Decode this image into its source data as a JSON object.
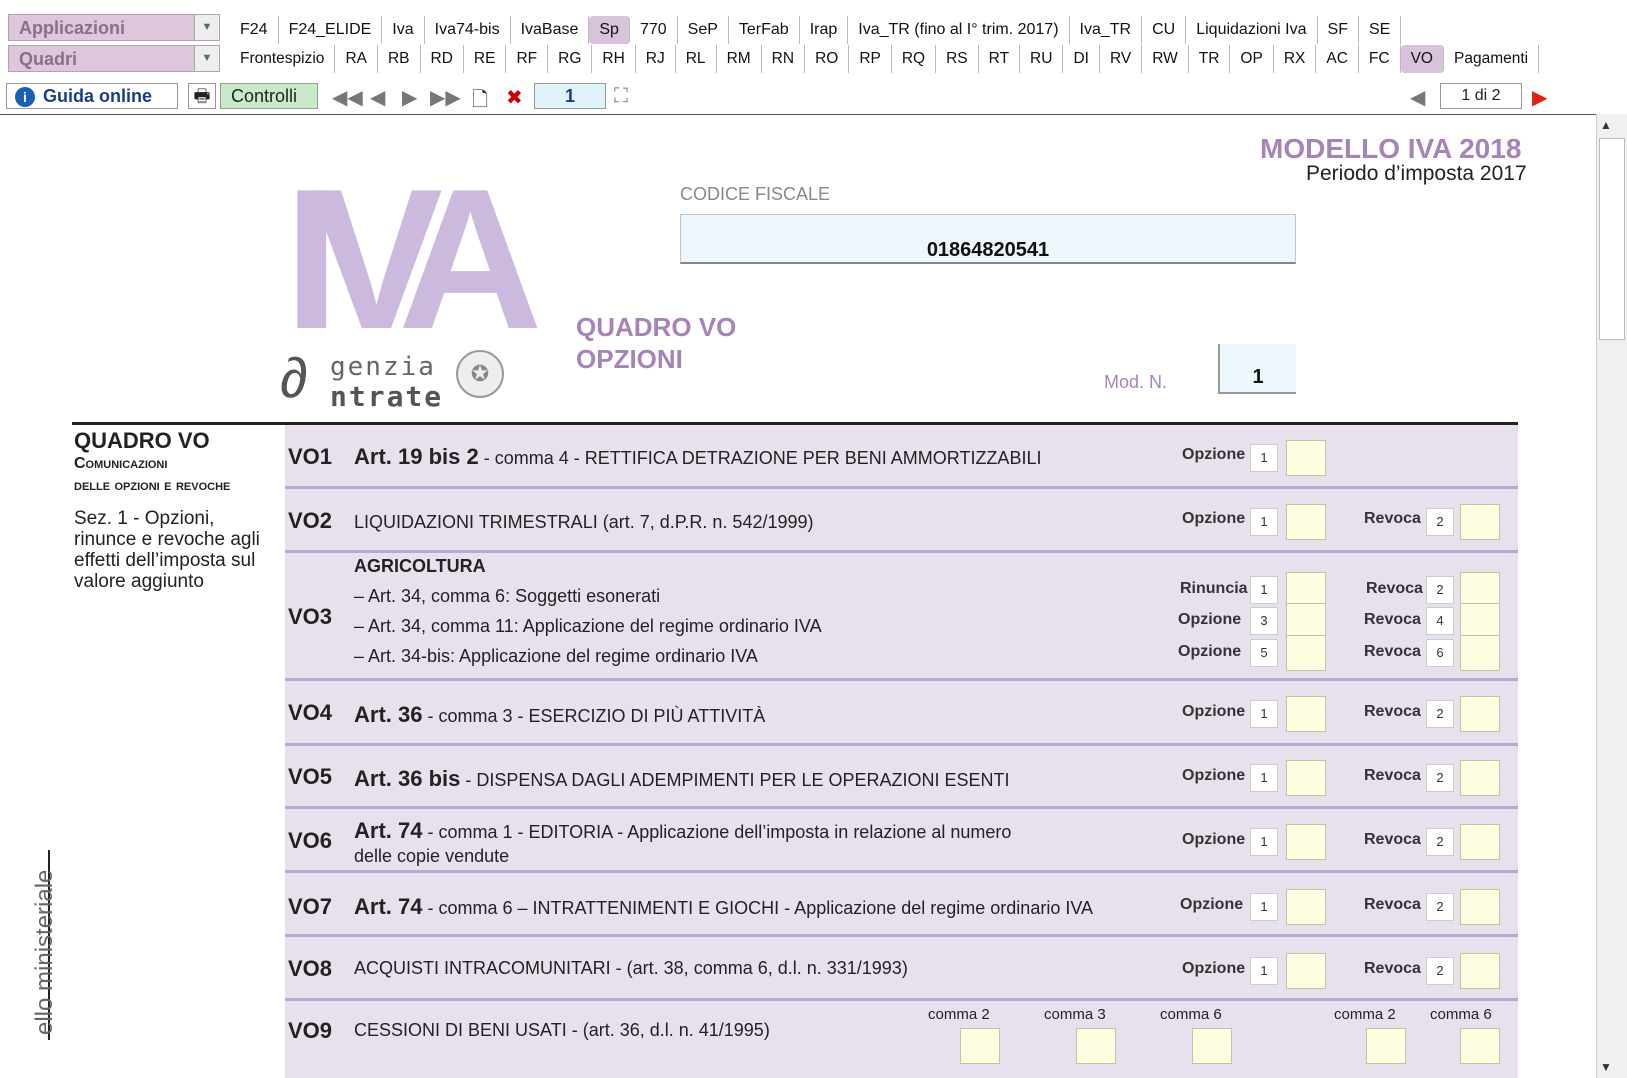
{
  "menus": {
    "applicazioni": "Applicazioni",
    "quadri": "Quadri"
  },
  "tabs_row1": [
    "F24",
    "F24_ELIDE",
    "Iva",
    "Iva74-bis",
    "IvaBase",
    "Sp",
    "770",
    "SeP",
    "TerFab",
    "Irap",
    "Iva_TR (fino al I° trim. 2017)",
    "Iva_TR",
    "CU",
    "Liquidazioni Iva",
    "SF",
    "SE"
  ],
  "tabs_row2": [
    "Frontespizio",
    "RA",
    "RB",
    "RD",
    "RE",
    "RF",
    "RG",
    "RH",
    "RJ",
    "RL",
    "RM",
    "RN",
    "RO",
    "RP",
    "RQ",
    "RS",
    "RT",
    "RU",
    "DI",
    "RV",
    "RW",
    "TR",
    "OP",
    "RX",
    "AC",
    "FC",
    "VO",
    "Pagamenti"
  ],
  "active_tab_row1": "Sp",
  "active_tab_row2": "VO",
  "toolbar": {
    "guida": "Guida online",
    "controlli": "Controlli",
    "page_input": "1",
    "page_of": "1 di 2"
  },
  "header": {
    "model_title": "MODELLO IVA 2018",
    "period": "Periodo d’imposta 2017",
    "logo_letters": "IVA",
    "agency_line1": "genzia",
    "agency_line2": "ntrate",
    "codice_fiscale_label": "CODICE FISCALE",
    "codice_fiscale": "01864820541",
    "quadro_title": "QUADRO VO",
    "quadro_subtitle": "OPZIONI",
    "mod_label": "Mod. N.",
    "mod_value": "1"
  },
  "left_panel": {
    "title": "QUADRO VO",
    "sub1": "Comunicazioni",
    "sub2": "delle opzioni e revoche",
    "sez": "Sez. 1 - Opzioni, rinunce e revoche agli effetti dell’imposta sul valore aggiunto",
    "vertical": "ello ministeriale"
  },
  "rows": {
    "vo1": {
      "code": "VO1",
      "art": "Art. 19 bis 2",
      "desc": " - comma 4 - RETTIFICA DETRAZIONE PER BENI AMMORTIZZABILI",
      "l1": "Opzione",
      "n1": "1"
    },
    "vo2": {
      "code": "VO2",
      "desc": "LIQUIDAZIONI TRIMESTRALI  (art. 7, d.P.R. n. 542/1999)",
      "l1": "Opzione",
      "n1": "1",
      "l2": "Revoca",
      "n2": "2"
    },
    "vo3": {
      "code": "VO3",
      "head": "AGRICOLTURA",
      "line1": "– Art. 34, comma   6: Soggetti esonerati",
      "line2": "– Art. 34, comma 11: Applicazione del regime ordinario IVA",
      "line3": "– Art. 34-bis: Applicazione del regime ordinario IVA",
      "a1": "Rinuncia",
      "an1": "1",
      "b1": "Revoca",
      "bn1": "2",
      "a2": "Opzione",
      "an2": "3",
      "b2": "Revoca",
      "bn2": "4",
      "a3": "Opzione",
      "an3": "5",
      "b3": "Revoca",
      "bn3": "6"
    },
    "vo4": {
      "code": "VO4",
      "art": "Art. 36",
      "desc": " - comma 3 - ESERCIZIO DI PIÙ ATTIVITÀ",
      "l1": "Opzione",
      "n1": "1",
      "l2": "Revoca",
      "n2": "2"
    },
    "vo5": {
      "code": "VO5",
      "art": "Art. 36 bis",
      "desc": " - DISPENSA DAGLI ADEMPIMENTI PER LE OPERAZIONI ESENTI",
      "l1": "Opzione",
      "n1": "1",
      "l2": "Revoca",
      "n2": "2"
    },
    "vo6": {
      "code": "VO6",
      "art": "Art. 74",
      "desc": " - comma 1 - EDITORIA - Applicazione dell’imposta in relazione al numero",
      "desc2": "delle copie vendute",
      "l1": "Opzione",
      "n1": "1",
      "l2": "Revoca",
      "n2": "2"
    },
    "vo7": {
      "code": "VO7",
      "art": "Art. 74",
      "desc": " - comma   6 – INTRATTENIMENTI E GIOCHI - Applicazione del regime ordinario IVA",
      "l1": "Opzione",
      "n1": "1",
      "l2": "Revoca",
      "n2": "2"
    },
    "vo8": {
      "code": "VO8",
      "desc": "ACQUISTI INTRACOMUNITARI - (art. 38, comma 6, d.l. n. 331/1993)",
      "l1": "Opzione",
      "n1": "1",
      "l2": "Revoca",
      "n2": "2"
    },
    "vo9": {
      "code": "VO9",
      "desc": "CESSIONI DI BENI USATI - (art. 36, d.l. n. 41/1995)",
      "c1": "comma 2",
      "c2": "comma 3",
      "c3": "comma 6",
      "c4": "comma 2",
      "c5": "comma 6"
    }
  }
}
